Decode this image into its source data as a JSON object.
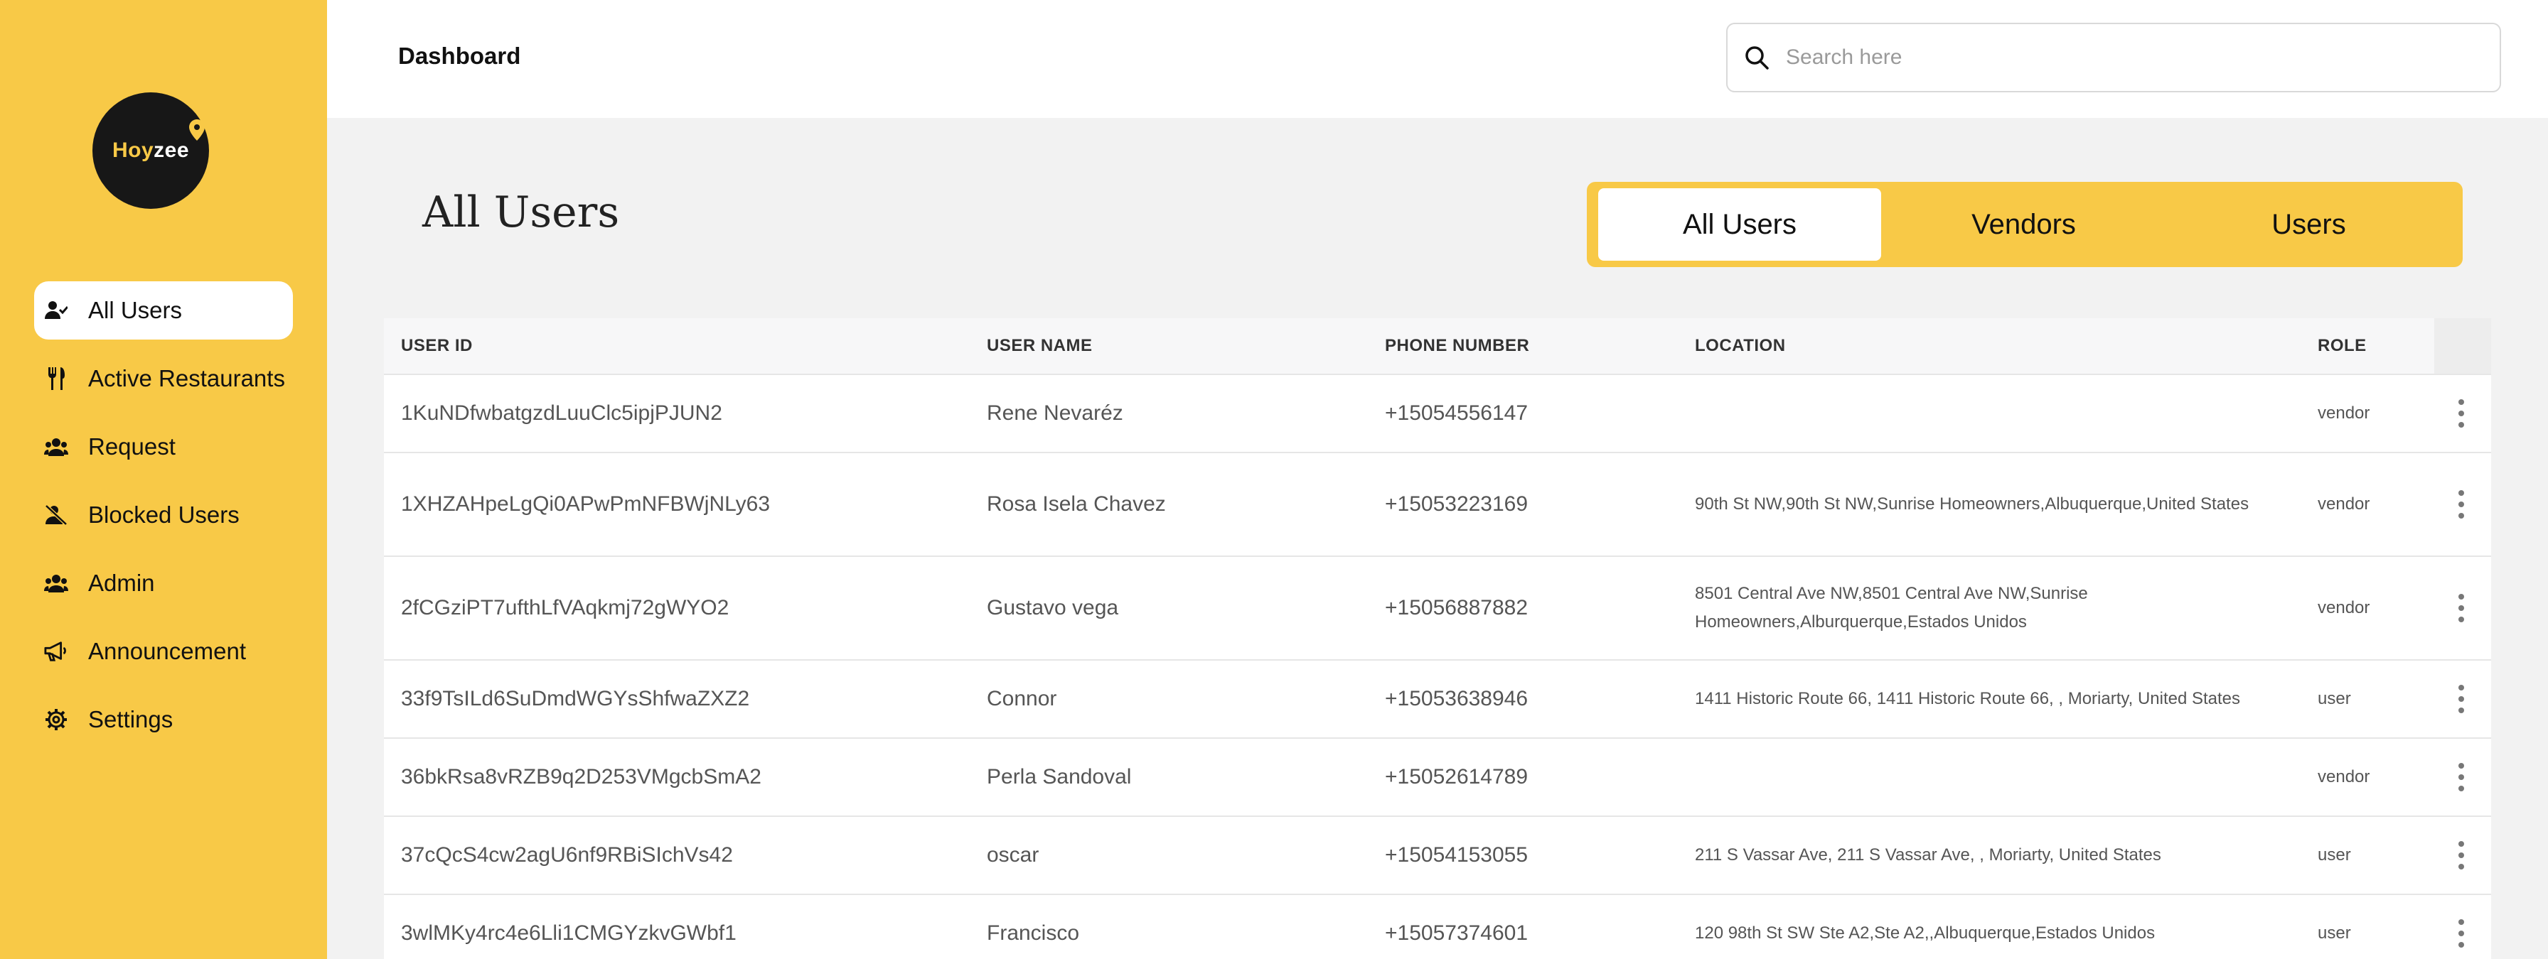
{
  "brand": {
    "logo_main": "Hoy",
    "logo_tail": "zee"
  },
  "sidebar": {
    "items": [
      {
        "label": "All Users",
        "icon": "user-check-icon",
        "active": true
      },
      {
        "label": "Active Restaurants",
        "icon": "utensils-icon",
        "active": false
      },
      {
        "label": "Request",
        "icon": "users-group-icon",
        "active": false
      },
      {
        "label": "Blocked Users",
        "icon": "user-block-icon",
        "active": false
      },
      {
        "label": "Admin",
        "icon": "users-group-icon",
        "active": false
      },
      {
        "label": "Announcement",
        "icon": "megaphone-icon",
        "active": false
      },
      {
        "label": "Settings",
        "icon": "gear-icon",
        "active": false
      }
    ]
  },
  "header": {
    "title": "Dashboard"
  },
  "search": {
    "placeholder": "Search here",
    "value": ""
  },
  "main": {
    "title": "All Users",
    "tabs": [
      {
        "label": "All Users",
        "active": true
      },
      {
        "label": "Vendors",
        "active": false
      },
      {
        "label": "Users",
        "active": false
      }
    ]
  },
  "table": {
    "columns": [
      "USER ID",
      "USER NAME",
      "PHONE NUMBER",
      "LOCATION",
      "ROLE"
    ],
    "rows": [
      {
        "id": "1KuNDfwbatgzdLuuClc5ipjPJUN2",
        "name": "Rene Nevaréz",
        "phone": "+15054556147",
        "location": "",
        "role": "vendor"
      },
      {
        "id": "1XHZAHpeLgQi0APwPmNFBWjNLy63",
        "name": "Rosa Isela Chavez",
        "phone": "+15053223169",
        "location": "90th St NW,90th St NW,Sunrise Homeowners,Albuquerque,United States",
        "role": "vendor"
      },
      {
        "id": "2fCGziPT7ufthLfVAqkmj72gWYO2",
        "name": "Gustavo vega",
        "phone": "+15056887882",
        "location": "8501 Central Ave NW,8501 Central Ave NW,Sunrise Homeowners,Alburquerque,Estados Unidos",
        "role": "vendor"
      },
      {
        "id": "33f9TsILd6SuDmdWGYsShfwaZXZ2",
        "name": "Connor",
        "phone": "+15053638946",
        "location": "1411 Historic Route 66, 1411 Historic Route 66, , Moriarty, United States",
        "role": "user"
      },
      {
        "id": "36bkRsa8vRZB9q2D253VMgcbSmA2",
        "name": "Perla Sandoval",
        "phone": "+15052614789",
        "location": "",
        "role": "vendor"
      },
      {
        "id": "37cQcS4cw2agU6nf9RBiSIchVs42",
        "name": "oscar",
        "phone": "+15054153055",
        "location": "211 S Vassar Ave, 211 S Vassar Ave, , Moriarty, United States",
        "role": "user"
      },
      {
        "id": "3wlMKy4rc4e6Lli1CMGYzkvGWbf1",
        "name": "Francisco",
        "phone": "+15057374601",
        "location": "120 98th St SW Ste A2,Ste A2,,Albuquerque,Estados Unidos",
        "role": "user"
      }
    ]
  }
}
